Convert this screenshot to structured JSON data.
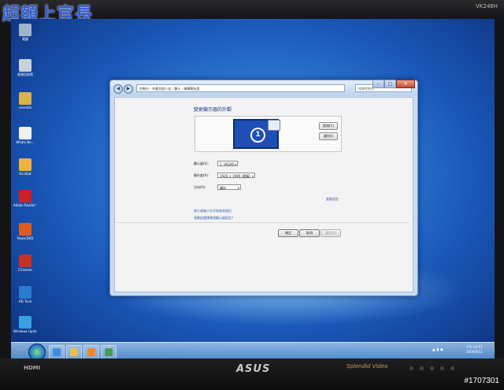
{
  "watermark": "超額上官長",
  "monitor": {
    "model": "VK246H",
    "hdmi_label": "HDMI",
    "brand": "ASUS",
    "splendid_label": "Splendid Video",
    "photo_id": "#1707301"
  },
  "desktop_icons": [
    {
      "label": "電腦",
      "color": "#9fb3cc"
    },
    {
      "label": "資源回收筒",
      "color": "#c9d2d8"
    },
    {
      "label": "coreinfo",
      "color": "#d9b24a"
    },
    {
      "label": "Whats Ne...",
      "color": "#f0f0f0"
    },
    {
      "label": "Acrobat",
      "color": "#f0b040"
    },
    {
      "label": "Adobe Reader 9",
      "color": "#cc1f1f"
    },
    {
      "label": "PowerDVD",
      "color": "#e05a1a"
    },
    {
      "label": "CCleaner",
      "color": "#c83020"
    },
    {
      "label": "HD Tune",
      "color": "#2a7ad0"
    },
    {
      "label": "Windows Update",
      "color": "#3aa0e0"
    }
  ],
  "window": {
    "address": "控制台 › 外觀及個人化 › 顯示 › 螢幕解析度",
    "search_placeholder": "搜尋控制台",
    "heading": "變更顯示器的外觀",
    "detect_button": "偵測(C)",
    "identify_button": "識別(I)",
    "monitor_number": "1",
    "display_label": "顯示器(S):",
    "display_value": "1. VK246",
    "resolution_label": "解析度(R):",
    "resolution_value": "1920 × 1080 (建議)",
    "orientation_label": "方向(O):",
    "orientation_value": "橫向",
    "advanced_link": "進階設定",
    "link_text_size": "放大或縮小文字和其他項目",
    "link_which_settings": "我應該選擇哪個顯示器設定?",
    "ok_button": "確定",
    "cancel_button": "取消",
    "apply_button": "套用(A)"
  },
  "taskbar": {
    "clock_time": "下午 03:57",
    "clock_date": "2009/9/12"
  }
}
